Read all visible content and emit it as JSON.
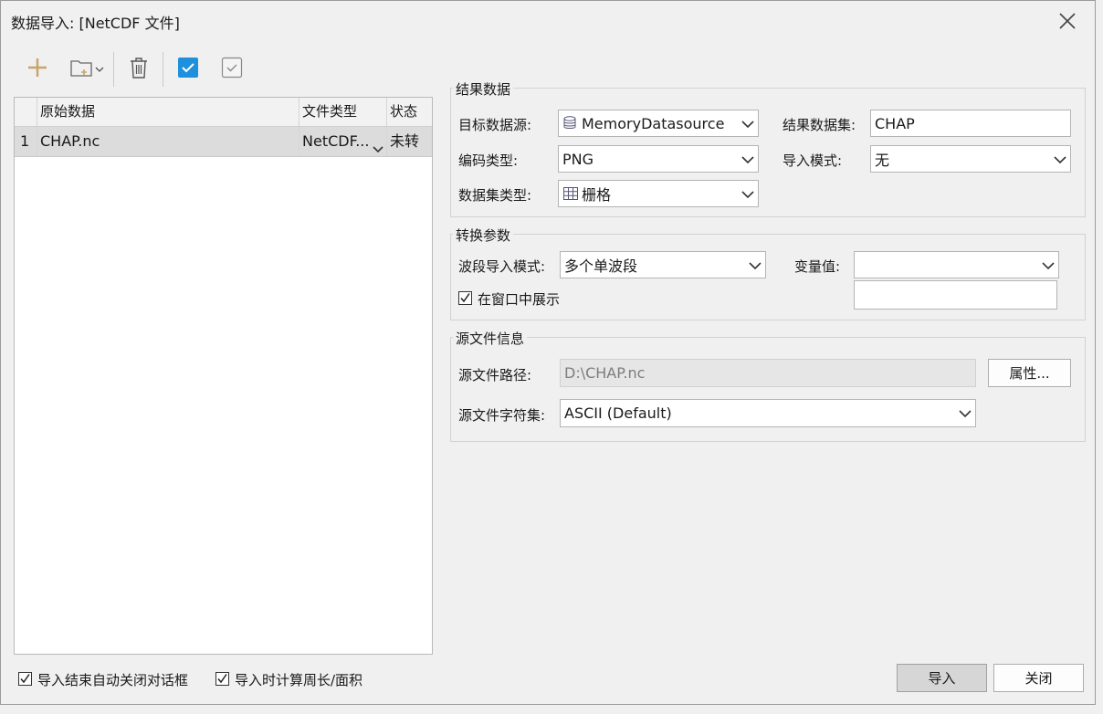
{
  "window": {
    "title": "数据导入: [NetCDF 文件]"
  },
  "grid": {
    "headers": {
      "index": "",
      "source": "原始数据",
      "type": "文件类型",
      "status": "状态"
    },
    "rows": [
      {
        "index": "1",
        "source": "CHAP.nc",
        "type": "NetCDF...",
        "status": "未转"
      }
    ]
  },
  "result_group": {
    "title": "结果数据",
    "target_datasource_label": "目标数据源:",
    "target_datasource_value": "MemoryDatasource",
    "result_dataset_label": "结果数据集:",
    "result_dataset_value": "CHAP",
    "encode_label": "编码类型:",
    "encode_value": "PNG",
    "import_mode_label": "导入模式:",
    "import_mode_value": "无",
    "dataset_type_label": "数据集类型:",
    "dataset_type_value": "栅格"
  },
  "convert_group": {
    "title": "转换参数",
    "band_mode_label": "波段导入模式:",
    "band_mode_value": "多个单波段",
    "variable_label": "变量值:",
    "variable_value": "",
    "show_in_window_label": "在窗口中展示",
    "show_in_window_checked": true
  },
  "source_group": {
    "title": "源文件信息",
    "path_label": "源文件路径:",
    "path_value": "D:\\CHAP.nc",
    "properties_button": "属性...",
    "charset_label": "源文件字符集:",
    "charset_value": "ASCII (Default)"
  },
  "footer": {
    "auto_close_label": "导入结束自动关闭对话框",
    "auto_close_checked": true,
    "calc_perimeter_label": "导入时计算周长/面积",
    "calc_perimeter_checked": true,
    "import_button": "导入",
    "close_button": "关闭"
  },
  "icons": {
    "close": "close-icon",
    "add": "plus-icon",
    "add_folder": "add-folder-icon",
    "delete": "trash-icon",
    "select_all": "checkbox-checked-icon",
    "select_inverse": "checkbox-outline-icon"
  },
  "colors": {
    "accent": "#1e90dc",
    "add_icon": "#c8a46a",
    "selected_row": "#dcdcdc"
  }
}
